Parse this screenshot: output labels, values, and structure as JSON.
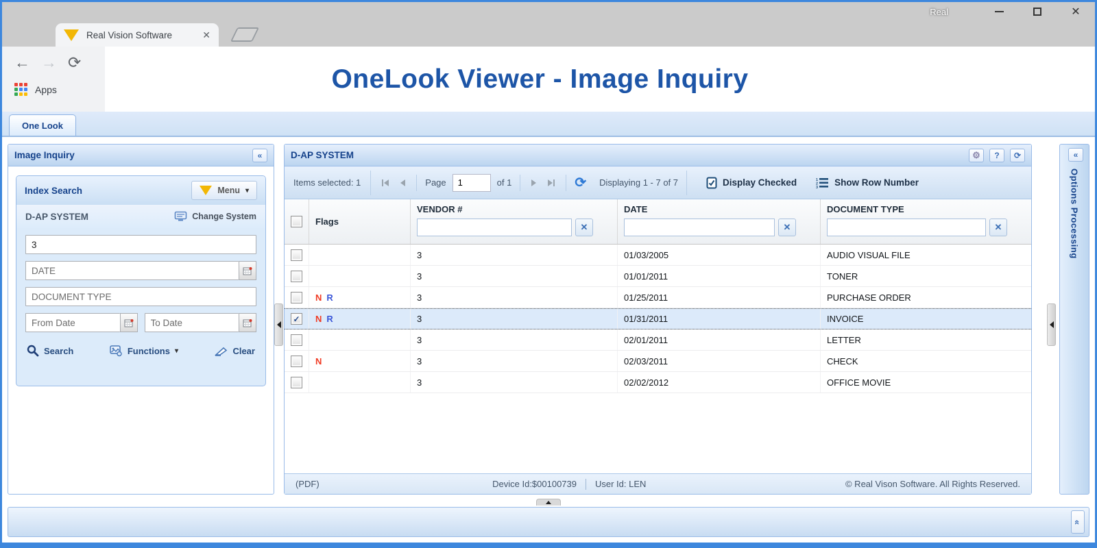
{
  "colors": {
    "accent": "#15428b",
    "title_blue": "#1d55a7",
    "window_border": "#3d87dd",
    "selected_row_bg": "#dceafa",
    "flag_colors": {
      "N": "#f03b24",
      "R": "#3a55d8"
    }
  },
  "browser": {
    "window_title": "Real",
    "tab_title": "Real Vision Software",
    "apps_label": "Apps"
  },
  "page": {
    "title": "OneLook Viewer - Image Inquiry",
    "app_tab": "One Look"
  },
  "left_panel": {
    "title": "Image Inquiry",
    "index_search": {
      "title": "Index Search",
      "menu_label": "Menu",
      "system_name": "D-AP SYSTEM",
      "change_system": "Change System",
      "key_value": "3",
      "date_placeholder": "DATE",
      "doc_type_placeholder": "DOCUMENT TYPE",
      "from_date_placeholder": "From Date",
      "to_date_placeholder": "To Date",
      "search_label": "Search",
      "functions_label": "Functions",
      "clear_label": "Clear"
    }
  },
  "grid": {
    "title": "D-AP SYSTEM",
    "items_selected": "Items selected: 1",
    "page_label": "Page",
    "page_value": "1",
    "page_of": "of 1",
    "displaying": "Displaying 1 - 7 of 7",
    "display_checked": "Display Checked",
    "show_row_number": "Show Row Number",
    "columns": {
      "flags": "Flags",
      "vendor": "VENDOR #",
      "date": "DATE",
      "doc_type": "DOCUMENT TYPE"
    },
    "rows": [
      {
        "checked": false,
        "selected": false,
        "flags": "",
        "vendor": "3",
        "date": "01/03/2005",
        "doc_type": "AUDIO VISUAL FILE"
      },
      {
        "checked": false,
        "selected": false,
        "flags": "",
        "vendor": "3",
        "date": "01/01/2011",
        "doc_type": "TONER"
      },
      {
        "checked": false,
        "selected": false,
        "flags": "N R",
        "vendor": "3",
        "date": "01/25/2011",
        "doc_type": "PURCHASE ORDER"
      },
      {
        "checked": true,
        "selected": true,
        "flags": "N R",
        "vendor": "3",
        "date": "01/31/2011",
        "doc_type": "INVOICE"
      },
      {
        "checked": false,
        "selected": false,
        "flags": "",
        "vendor": "3",
        "date": "02/01/2011",
        "doc_type": "LETTER"
      },
      {
        "checked": false,
        "selected": false,
        "flags": "N",
        "vendor": "3",
        "date": "02/03/2011",
        "doc_type": "CHECK"
      },
      {
        "checked": false,
        "selected": false,
        "flags": "",
        "vendor": "3",
        "date": "02/02/2012",
        "doc_type": "OFFICE MOVIE"
      }
    ],
    "footer": {
      "format": "(PDF)",
      "device_id": "Device Id:$00100739",
      "user_id": "User Id: LEN",
      "copyright": "© Real Vison Software. All Rights Reserved."
    }
  },
  "options_panel": {
    "title": "Options Processing"
  },
  "icons": {
    "collapse": "«",
    "help": "?",
    "refresh": "⟳",
    "reload": "⟳",
    "back": "←",
    "forward": "→",
    "close": "✕",
    "multiply": "✕",
    "caret_down": "▾",
    "check": "✓",
    "gear": "⚙"
  }
}
